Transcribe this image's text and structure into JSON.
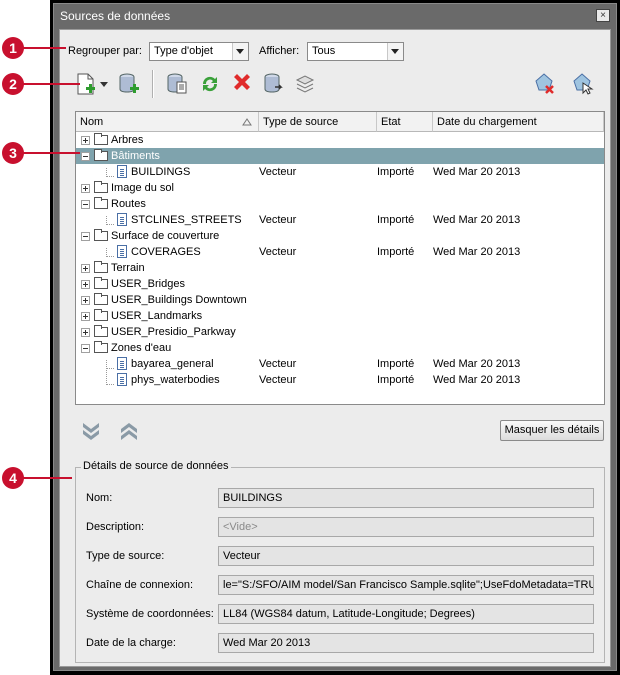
{
  "window": {
    "title": "Sources de données",
    "close_glyph": "×"
  },
  "toolbar_top": {
    "group_label": "Regrouper par:",
    "group_value": "Type d'objet",
    "show_label": "Afficher:",
    "show_value": "Tous"
  },
  "toolbar_icons": [
    "new-source-icon",
    "add-data-source-icon",
    "source-properties-icon",
    "refresh-icon",
    "delete-icon",
    "reload-icon",
    "layers-icon",
    "remove-feature-icon",
    "select-feature-icon"
  ],
  "tree": {
    "headers": [
      "Nom",
      "Type de source",
      "Etat",
      "Date du chargement"
    ],
    "rows": [
      {
        "name": "Arbres",
        "type": "",
        "state": "",
        "date": ""
      },
      {
        "name": "Bâtiments",
        "type": "",
        "state": "",
        "date": ""
      },
      {
        "name": "BUILDINGS",
        "type": "Vecteur",
        "state": "Importé",
        "date": "Wed Mar 20 2013"
      },
      {
        "name": "Image du sol",
        "type": "",
        "state": "",
        "date": ""
      },
      {
        "name": "Routes",
        "type": "",
        "state": "",
        "date": ""
      },
      {
        "name": "STCLINES_STREETS",
        "type": "Vecteur",
        "state": "Importé",
        "date": "Wed Mar 20 2013"
      },
      {
        "name": "Surface de couverture",
        "type": "",
        "state": "",
        "date": ""
      },
      {
        "name": "COVERAGES",
        "type": "Vecteur",
        "state": "Importé",
        "date": "Wed Mar 20 2013"
      },
      {
        "name": "Terrain",
        "type": "",
        "state": "",
        "date": ""
      },
      {
        "name": "USER_Bridges",
        "type": "",
        "state": "",
        "date": ""
      },
      {
        "name": "USER_Buildings Downtown",
        "type": "",
        "state": "",
        "date": ""
      },
      {
        "name": "USER_Landmarks",
        "type": "",
        "state": "",
        "date": ""
      },
      {
        "name": "USER_Presidio_Parkway",
        "type": "",
        "state": "",
        "date": ""
      },
      {
        "name": "Zones d'eau",
        "type": "",
        "state": "",
        "date": ""
      },
      {
        "name": "bayarea_general",
        "type": "Vecteur",
        "state": "Importé",
        "date": "Wed Mar 20 2013"
      },
      {
        "name": "phys_waterbodies",
        "type": "Vecteur",
        "state": "Importé",
        "date": "Wed Mar 20 2013"
      }
    ]
  },
  "details_button": "Masquer les détails",
  "details": {
    "group_title": "Détails de source de données",
    "name_label": "Nom:",
    "name_value": "BUILDINGS",
    "desc_label": "Description:",
    "desc_value": "<Vide>",
    "type_label": "Type de source:",
    "type_value": "Vecteur",
    "conn_label": "Chaîne de connexion:",
    "conn_value": "le=\"S:/SFO/AIM model/San Francisco Sample.sqlite\";UseFdoMetadata=TRUE",
    "crs_label": "Système de coordonnées:",
    "crs_value": "LL84 (WGS84 datum, Latitude-Longitude; Degrees)",
    "date_label": "Date de la charge:",
    "date_value": "Wed Mar 20 2013"
  },
  "callouts": [
    "1",
    "2",
    "3",
    "4"
  ],
  "colors": {
    "callout": "#c8102e",
    "selection": "#7fa3ad",
    "title_bar": "#6a6a6a"
  }
}
